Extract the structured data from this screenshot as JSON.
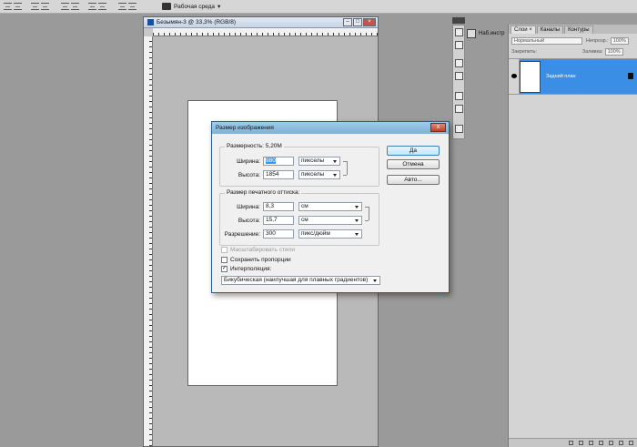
{
  "workspace": {
    "label": "Рабочая среда"
  },
  "document": {
    "title": "Безымян-3 @ 33,3% (RGB/8)"
  },
  "tools": {
    "nav_label": "Наб.инстр"
  },
  "layers_panel": {
    "tabs": [
      {
        "label": "Слои ×"
      },
      {
        "label": "Каналы"
      },
      {
        "label": "Контуры"
      }
    ],
    "blend_mode": "Нормальный",
    "opacity_label": "Непрозр.:",
    "opacity_value": "100%",
    "lock_label": "Закрепить:",
    "fill_label": "Заливка:",
    "fill_value": "100%",
    "layer_name": "Задний план"
  },
  "dialog": {
    "title": "Размер изображения",
    "close_glyph": "x",
    "pixel_dims": {
      "label": "Размерность: 5,20M",
      "width_label": "Ширина:",
      "width_value": "980",
      "width_unit": "пикселы",
      "height_label": "Высота:",
      "height_value": "1854",
      "height_unit": "пикселы"
    },
    "doc_size": {
      "label": "Размер печатного оттиска:",
      "width_label": "Ширина:",
      "width_value": "8,3",
      "width_unit": "см",
      "height_label": "Высота:",
      "height_value": "15,7",
      "height_unit": "см",
      "resolution_label": "Разрешение:",
      "resolution_value": "300",
      "resolution_unit": "пикс/дюйм"
    },
    "options": {
      "scale_styles": "Масштабировать стили",
      "constrain": "Сохранить пропорции",
      "resample": "Интерполяция:",
      "resample_method": "Бикубическая (наилучшая для плавных градиентов)"
    },
    "buttons": {
      "ok": "Да",
      "cancel": "Отмена",
      "auto": "Авто..."
    }
  }
}
